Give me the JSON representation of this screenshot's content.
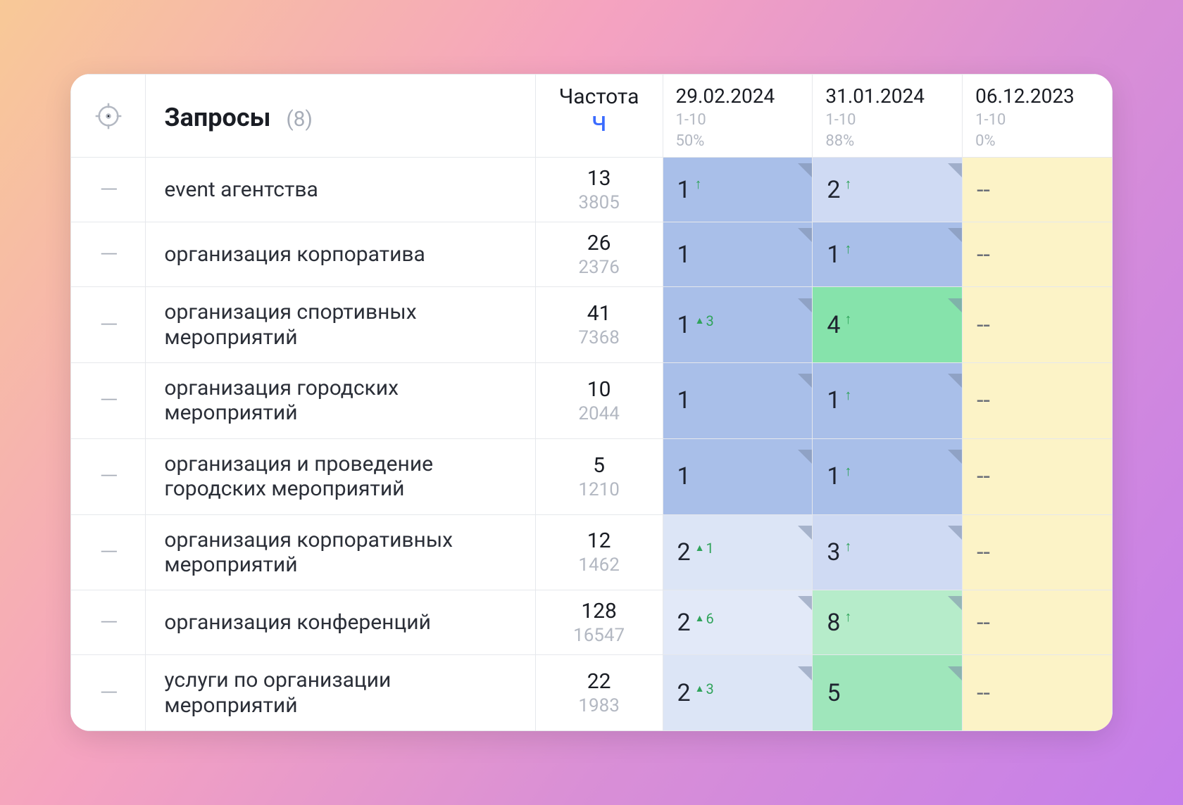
{
  "header": {
    "queries_title": "Запросы",
    "queries_count": "(8)",
    "freq_label": "Частота",
    "freq_sub": "Ч",
    "dates": [
      {
        "label": "29.02.2024",
        "range": "1-10",
        "pct": "50%"
      },
      {
        "label": "31.01.2024",
        "range": "1-10",
        "pct": "88%"
      },
      {
        "label": "06.12.2023",
        "range": "1-10",
        "pct": "0%"
      }
    ]
  },
  "rows": [
    {
      "query": "event агентства",
      "freq1": "13",
      "freq2": "3805",
      "c1": {
        "val": "1",
        "cls": "blue-1",
        "arrow": true,
        "corner": true
      },
      "c2": {
        "val": "2",
        "cls": "blue-2",
        "arrow": true,
        "corner": true
      },
      "c3": {
        "val": "--",
        "cls": "empty"
      }
    },
    {
      "query": "организация корпоратива",
      "freq1": "26",
      "freq2": "2376",
      "c1": {
        "val": "1",
        "cls": "blue-1",
        "corner": true
      },
      "c2": {
        "val": "1",
        "cls": "blue-1",
        "arrow": true,
        "corner": true
      },
      "c3": {
        "val": "--",
        "cls": "empty"
      }
    },
    {
      "query": "организация спортивных мероприятий",
      "freq1": "41",
      "freq2": "7368",
      "c1": {
        "val": "1",
        "cls": "blue-1",
        "delta": "3",
        "corner": true
      },
      "c2": {
        "val": "4",
        "cls": "green-1",
        "arrow": true,
        "corner": true
      },
      "c3": {
        "val": "--",
        "cls": "empty"
      }
    },
    {
      "query": "организация городских мероприятий",
      "freq1": "10",
      "freq2": "2044",
      "c1": {
        "val": "1",
        "cls": "blue-1",
        "corner": true
      },
      "c2": {
        "val": "1",
        "cls": "blue-1",
        "arrow": true,
        "corner": true
      },
      "c3": {
        "val": "--",
        "cls": "empty"
      }
    },
    {
      "query": "организация и проведение городских мероприятий",
      "freq1": "5",
      "freq2": "1210",
      "c1": {
        "val": "1",
        "cls": "blue-1",
        "corner": true
      },
      "c2": {
        "val": "1",
        "cls": "blue-1",
        "arrow": true,
        "corner": true
      },
      "c3": {
        "val": "--",
        "cls": "empty"
      }
    },
    {
      "query": "организация корпоративных мероприятий",
      "freq1": "12",
      "freq2": "1462",
      "c1": {
        "val": "2",
        "cls": "blue-3",
        "delta": "1",
        "corner": true
      },
      "c2": {
        "val": "3",
        "cls": "blue-2",
        "arrow": true,
        "corner": true
      },
      "c3": {
        "val": "--",
        "cls": "empty"
      }
    },
    {
      "query": "организация конференций",
      "freq1": "128",
      "freq2": "16547",
      "c1": {
        "val": "2",
        "cls": "blue-4",
        "delta": "6",
        "corner": true
      },
      "c2": {
        "val": "8",
        "cls": "green-2",
        "arrow": true,
        "corner": true
      },
      "c3": {
        "val": "--",
        "cls": "empty"
      }
    },
    {
      "query": "услуги по организации мероприятий",
      "freq1": "22",
      "freq2": "1983",
      "c1": {
        "val": "2",
        "cls": "blue-3",
        "delta": "3",
        "corner": true
      },
      "c2": {
        "val": "5",
        "cls": "green-3",
        "corner": true
      },
      "c3": {
        "val": "--",
        "cls": "empty"
      }
    }
  ]
}
